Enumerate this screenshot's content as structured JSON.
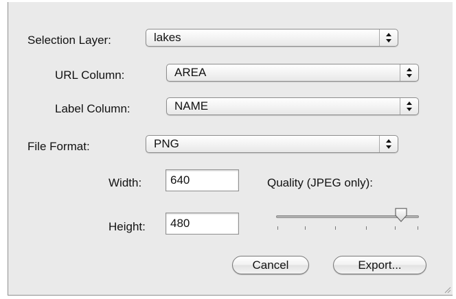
{
  "selection_layer": {
    "label": "Selection Layer:",
    "value": "lakes"
  },
  "url_column": {
    "label": "URL Column:",
    "value": "AREA"
  },
  "label_column": {
    "label": "Label Column:",
    "value": "NAME"
  },
  "file_format": {
    "label": "File Format:",
    "value": "PNG"
  },
  "width": {
    "label": "Width:",
    "value": "640"
  },
  "height": {
    "label": "Height:",
    "value": "480"
  },
  "quality": {
    "label": "Quality (JPEG only):",
    "level_fraction": 0.88
  },
  "buttons": {
    "cancel": "Cancel",
    "export": "Export..."
  }
}
